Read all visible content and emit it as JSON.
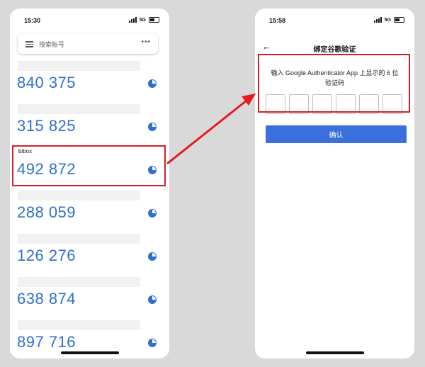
{
  "left_phone": {
    "status": {
      "time": "15:30",
      "network": "5G"
    },
    "search": {
      "placeholder": "搜索帐号",
      "more": "•••"
    },
    "accounts": [
      {
        "name": "",
        "code": "840 375"
      },
      {
        "name": "",
        "code": "315 825"
      },
      {
        "name": "bibox",
        "code": "492 872",
        "highlighted": true
      },
      {
        "name": "",
        "code": "288 059"
      },
      {
        "name": "",
        "code": "126 276"
      },
      {
        "name": "",
        "code": "638 874"
      },
      {
        "name": "",
        "code": "897 716"
      }
    ]
  },
  "right_phone": {
    "status": {
      "time": "15:58",
      "network": "5G"
    },
    "nav": {
      "back": "←",
      "title": "绑定谷歌验证"
    },
    "prompt_line1": "输入 Google Authenticator App 上显示的 6 位",
    "prompt_line2": "验证码",
    "digit_count": 6,
    "confirm_label": "确认"
  },
  "colors": {
    "code_blue": "#2e6fd0",
    "button_blue": "#3a6fdc",
    "highlight_red": "#d32028",
    "arrow_red": "#e31b23"
  }
}
